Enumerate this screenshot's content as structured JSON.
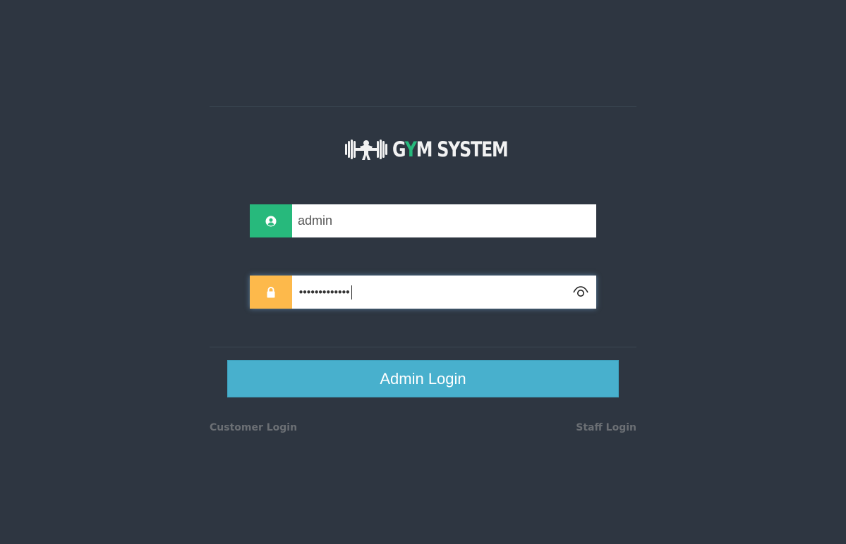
{
  "brand": {
    "name_prefix": "G",
    "name_accent": "Y",
    "name_suffix": "M SYSTEM",
    "accent_color": "#27b97c",
    "logo_icon": "dumbbell-icon"
  },
  "form": {
    "username": {
      "value": "admin",
      "icon": "user-circle-icon",
      "addon_color": "#27b97c"
    },
    "password": {
      "masked_value": "•••••••••••••",
      "icon": "lock-icon",
      "addon_color": "#fdb94b",
      "toggle_icon": "eye-icon"
    },
    "submit_label": "Admin Login",
    "submit_color": "#48b0cd"
  },
  "links": {
    "customer_login": "Customer Login",
    "staff_login": "Staff Login"
  },
  "colors": {
    "background": "#2e3641"
  }
}
